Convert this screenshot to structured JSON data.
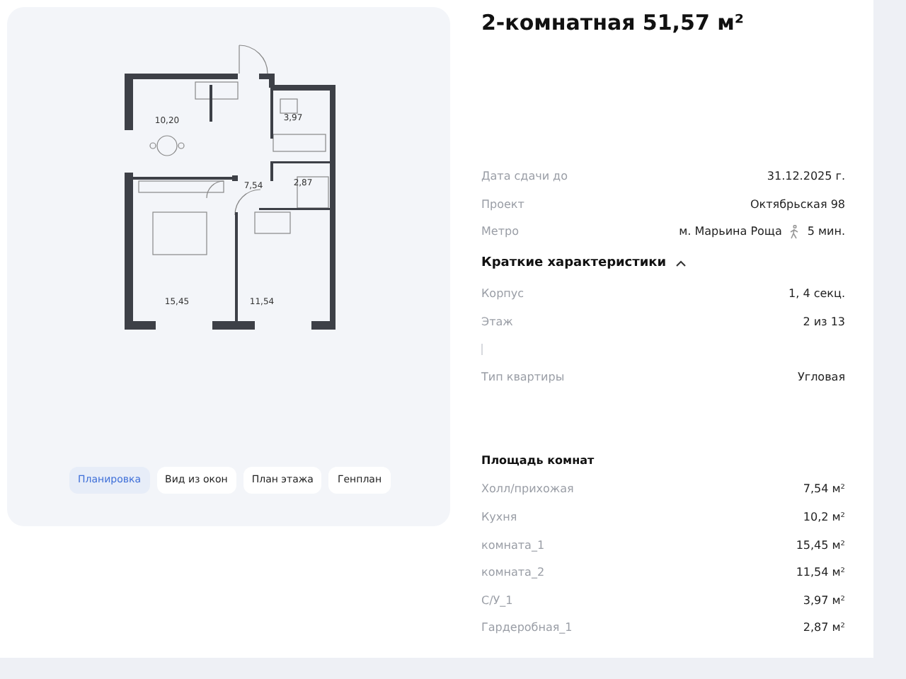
{
  "floor_plan": {
    "room_labels": [
      "10,20",
      "3,97",
      "7,54",
      "2,87",
      "15,45",
      "11,54"
    ]
  },
  "view_tabs": [
    {
      "label": "Планировка",
      "selected": true
    },
    {
      "label": "Вид из окон",
      "selected": false
    },
    {
      "label": "План этажа",
      "selected": false
    },
    {
      "label": "Генплан",
      "selected": false
    }
  ],
  "title": "2-комнатная 51,57 м²",
  "info_rows": [
    {
      "label": "Дата сдачи до",
      "value": "31.12.2025 г."
    },
    {
      "label": "Проект",
      "value": "Октябрьская 98"
    }
  ],
  "metro": {
    "label": "Метро",
    "station": "м. Марьина Роща",
    "walk_time": "5 мин."
  },
  "characteristics": {
    "title": "Краткие характеристики",
    "expanded": true,
    "rows": [
      {
        "label": "Корпус",
        "value": "1, 4 секц."
      },
      {
        "label": "Этаж",
        "value": "2 из 13"
      },
      {
        "label": "Тип квартиры",
        "value": "Угловая"
      }
    ]
  },
  "room_areas": {
    "title": "Площадь комнат",
    "rows": [
      {
        "label": "Холл/прихожая",
        "value": "7,54 м²"
      },
      {
        "label": "Кухня",
        "value": "10,2 м²"
      },
      {
        "label": "комната_1",
        "value": "15,45 м²"
      },
      {
        "label": "комната_2",
        "value": "11,54 м²"
      },
      {
        "label": "С/У_1",
        "value": "3,97 м²"
      },
      {
        "label": "Гардеробная_1",
        "value": "2,87 м²"
      }
    ]
  }
}
